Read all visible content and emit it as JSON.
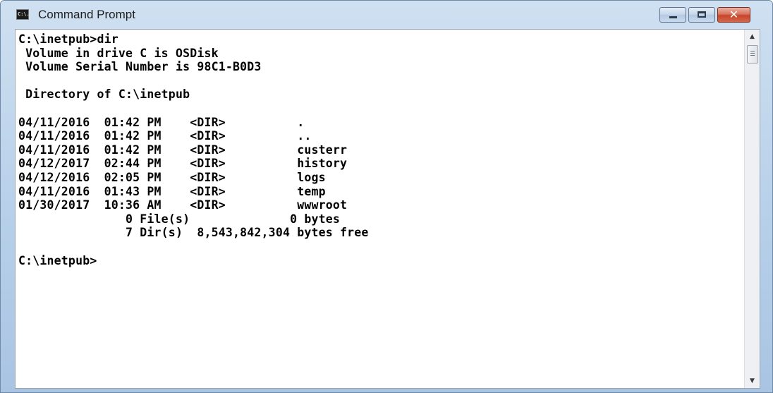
{
  "window": {
    "title": "Command Prompt",
    "icon": "cmd-icon",
    "icon_text": "C:\\.",
    "controls": {
      "minimize": "minimize-icon",
      "maximize": "maximize-icon",
      "close": "close-icon",
      "close_glyph": "✕"
    },
    "colors": {
      "titlebar": "#b9d1ea",
      "close_button": "#c7442c",
      "console_bg": "#ffffff",
      "console_text": "#000000"
    }
  },
  "console": {
    "lines": [
      "C:\\inetpub>dir",
      " Volume in drive C is OSDisk",
      " Volume Serial Number is 98C1-B0D3",
      "",
      " Directory of C:\\inetpub",
      "",
      "04/11/2016  01:42 PM    <DIR>          .",
      "04/11/2016  01:42 PM    <DIR>          ..",
      "04/11/2016  01:42 PM    <DIR>          custerr",
      "04/12/2017  02:44 PM    <DIR>          history",
      "04/12/2016  02:05 PM    <DIR>          logs",
      "04/11/2016  01:43 PM    <DIR>          temp",
      "01/30/2017  10:36 AM    <DIR>          wwwroot",
      "               0 File(s)              0 bytes",
      "               7 Dir(s)  8,543,842,304 bytes free",
      "",
      "C:\\inetpub>"
    ]
  },
  "scrollbar": {
    "up_glyph": "▲",
    "down_glyph": "▼"
  }
}
